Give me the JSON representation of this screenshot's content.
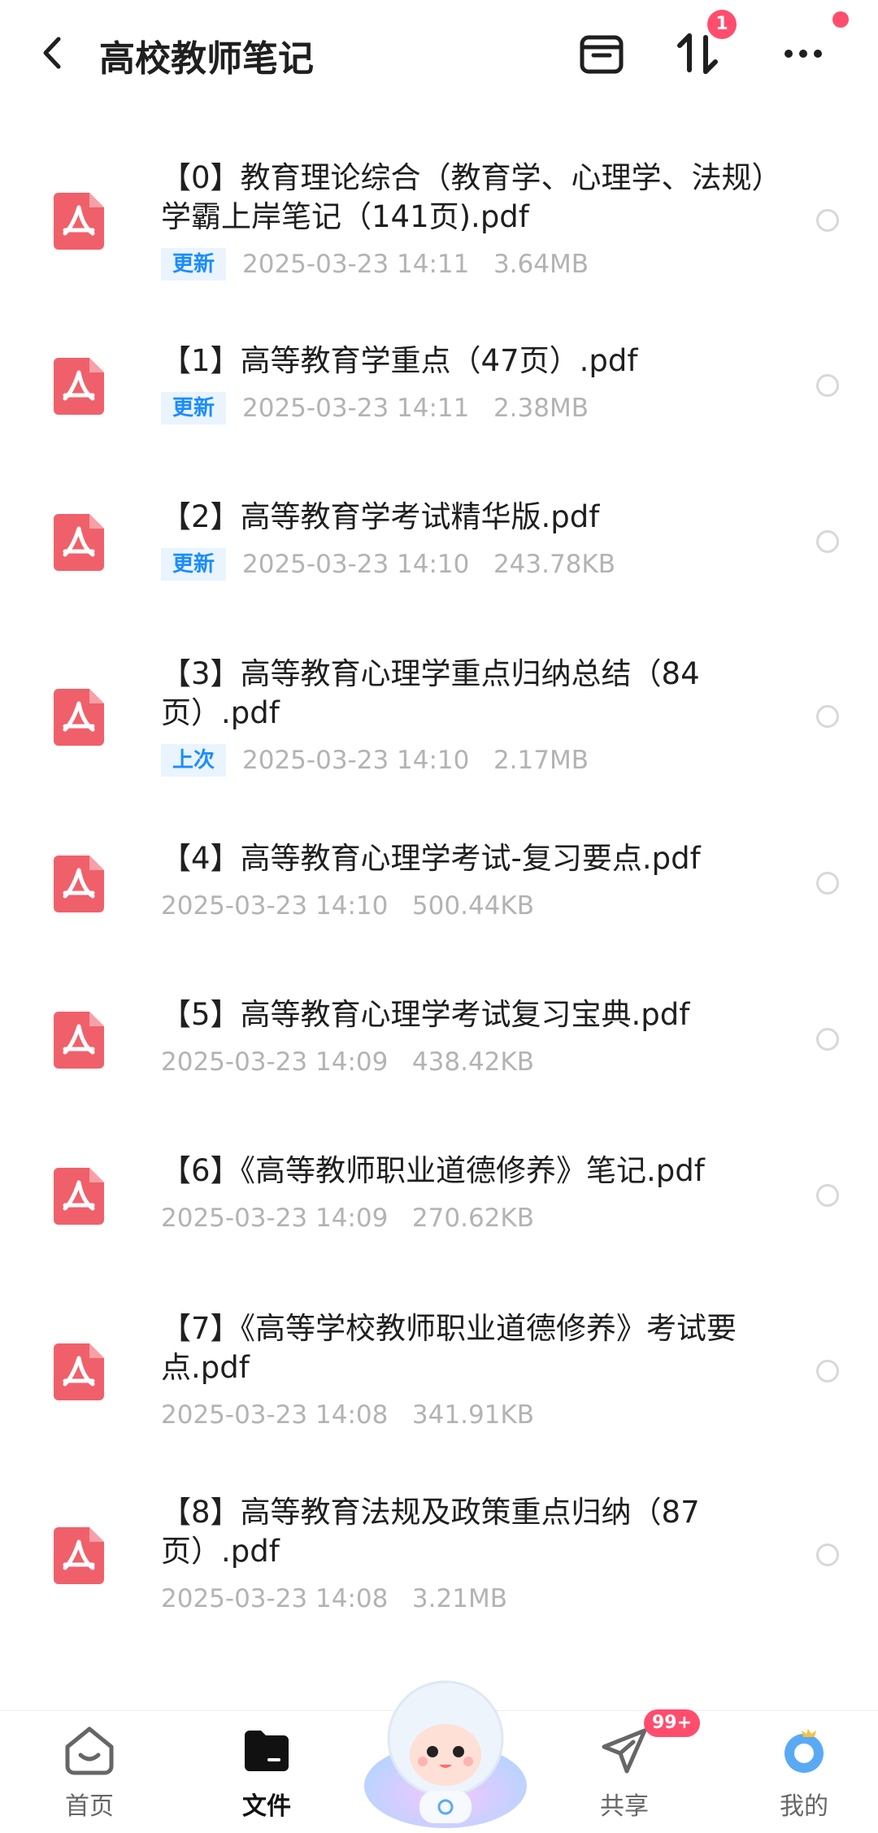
{
  "header": {
    "title": "高校教师笔记",
    "notification_count": "1",
    "icons": [
      "back-icon",
      "archive-icon",
      "sort-icon",
      "more-icon"
    ]
  },
  "files": [
    {
      "name": "【0】教育理论综合（教育学、心理学、法规）学霸上岸笔记（141页).pdf",
      "tag": "更新",
      "date": "2025-03-23  14:11",
      "size": "3.64MB"
    },
    {
      "name": "【1】高等教育学重点（47页）.pdf",
      "tag": "更新",
      "date": "2025-03-23  14:11",
      "size": "2.38MB"
    },
    {
      "name": "【2】高等教育学考试精华版.pdf",
      "tag": "更新",
      "date": "2025-03-23  14:10",
      "size": "243.78KB"
    },
    {
      "name": "【3】高等教育心理学重点归纳总结（84页）.pdf",
      "tag": "上次",
      "date": "2025-03-23  14:10",
      "size": "2.17MB"
    },
    {
      "name": "【4】高等教育心理学考试-复习要点.pdf",
      "tag": "",
      "date": "2025-03-23  14:10",
      "size": "500.44KB"
    },
    {
      "name": "【5】高等教育心理学考试复习宝典.pdf",
      "tag": "",
      "date": "2025-03-23  14:09",
      "size": "438.42KB"
    },
    {
      "name": "【6】《高等教师职业道德修养》笔记.pdf",
      "tag": "",
      "date": "2025-03-23  14:09",
      "size": "270.62KB"
    },
    {
      "name": "【7】《高等学校教师职业道德修养》考试要点.pdf",
      "tag": "",
      "date": "2025-03-23  14:08",
      "size": "341.91KB"
    },
    {
      "name": "【8】高等教育法规及政策重点归纳（87页）.pdf",
      "tag": "",
      "date": "2025-03-23  14:08",
      "size": "3.21MB"
    }
  ],
  "nav": {
    "home": "首页",
    "files": "文件",
    "share": "共享",
    "mine": "我的",
    "share_badge": "99+"
  },
  "colors": {
    "accent": "#1a8cff",
    "badge": "#ff4d6d",
    "pdf": "#f0606a"
  }
}
